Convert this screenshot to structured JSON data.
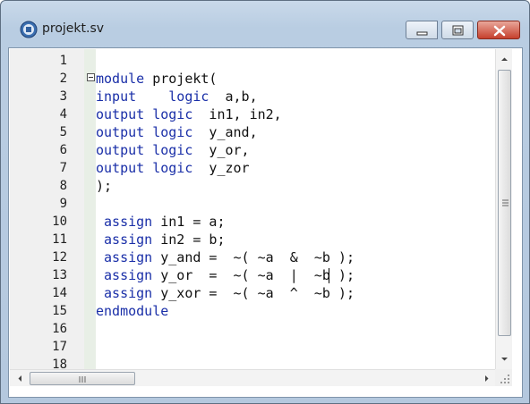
{
  "window": {
    "title": "projekt.sv",
    "icon": "systemverilog-file-icon",
    "controls": [
      "minimize",
      "maximize",
      "close"
    ]
  },
  "editor": {
    "line_numbers": [
      "1",
      "2",
      "3",
      "4",
      "5",
      "6",
      "7",
      "8",
      "9",
      "10",
      "11",
      "12",
      "13",
      "14",
      "15",
      "16",
      "17",
      "18"
    ],
    "lines": [
      [],
      [
        {
          "t": "module",
          "k": true
        },
        {
          "t": " projekt("
        }
      ],
      [
        {
          "t": "input",
          "k": true
        },
        {
          "t": "    "
        },
        {
          "t": "logic",
          "k": true
        },
        {
          "t": "  a,b,"
        }
      ],
      [
        {
          "t": "output",
          "k": true
        },
        {
          "t": " "
        },
        {
          "t": "logic",
          "k": true
        },
        {
          "t": "  in1, in2,"
        }
      ],
      [
        {
          "t": "output",
          "k": true
        },
        {
          "t": " "
        },
        {
          "t": "logic",
          "k": true
        },
        {
          "t": "  y_and,"
        }
      ],
      [
        {
          "t": "output",
          "k": true
        },
        {
          "t": " "
        },
        {
          "t": "logic",
          "k": true
        },
        {
          "t": "  y_or,"
        }
      ],
      [
        {
          "t": "output",
          "k": true
        },
        {
          "t": " "
        },
        {
          "t": "logic",
          "k": true
        },
        {
          "t": "  y_zor"
        }
      ],
      [
        {
          "t": ");"
        }
      ],
      [],
      [
        {
          "t": " "
        },
        {
          "t": "assign",
          "k": true
        },
        {
          "t": " in1 = a;"
        }
      ],
      [
        {
          "t": " "
        },
        {
          "t": "assign",
          "k": true
        },
        {
          "t": " in2 = b;"
        }
      ],
      [
        {
          "t": " "
        },
        {
          "t": "assign",
          "k": true
        },
        {
          "t": " y_and =  ~( ~a  &  ~b );"
        }
      ],
      [
        {
          "t": " "
        },
        {
          "t": "assign",
          "k": true
        },
        {
          "t": " y_or  =  ~( ~a  |  ~b );"
        }
      ],
      [
        {
          "t": " "
        },
        {
          "t": "assign",
          "k": true
        },
        {
          "t": " y_xor =  ~( ~a  ^  ~b );"
        }
      ],
      [
        {
          "t": "endmodule",
          "k": true
        }
      ],
      [],
      [],
      []
    ],
    "colors": {
      "keyword": "#1a2fa8",
      "text": "#111111",
      "gutter": "#f0f0f0",
      "fold_column": "#e8efe6"
    }
  }
}
